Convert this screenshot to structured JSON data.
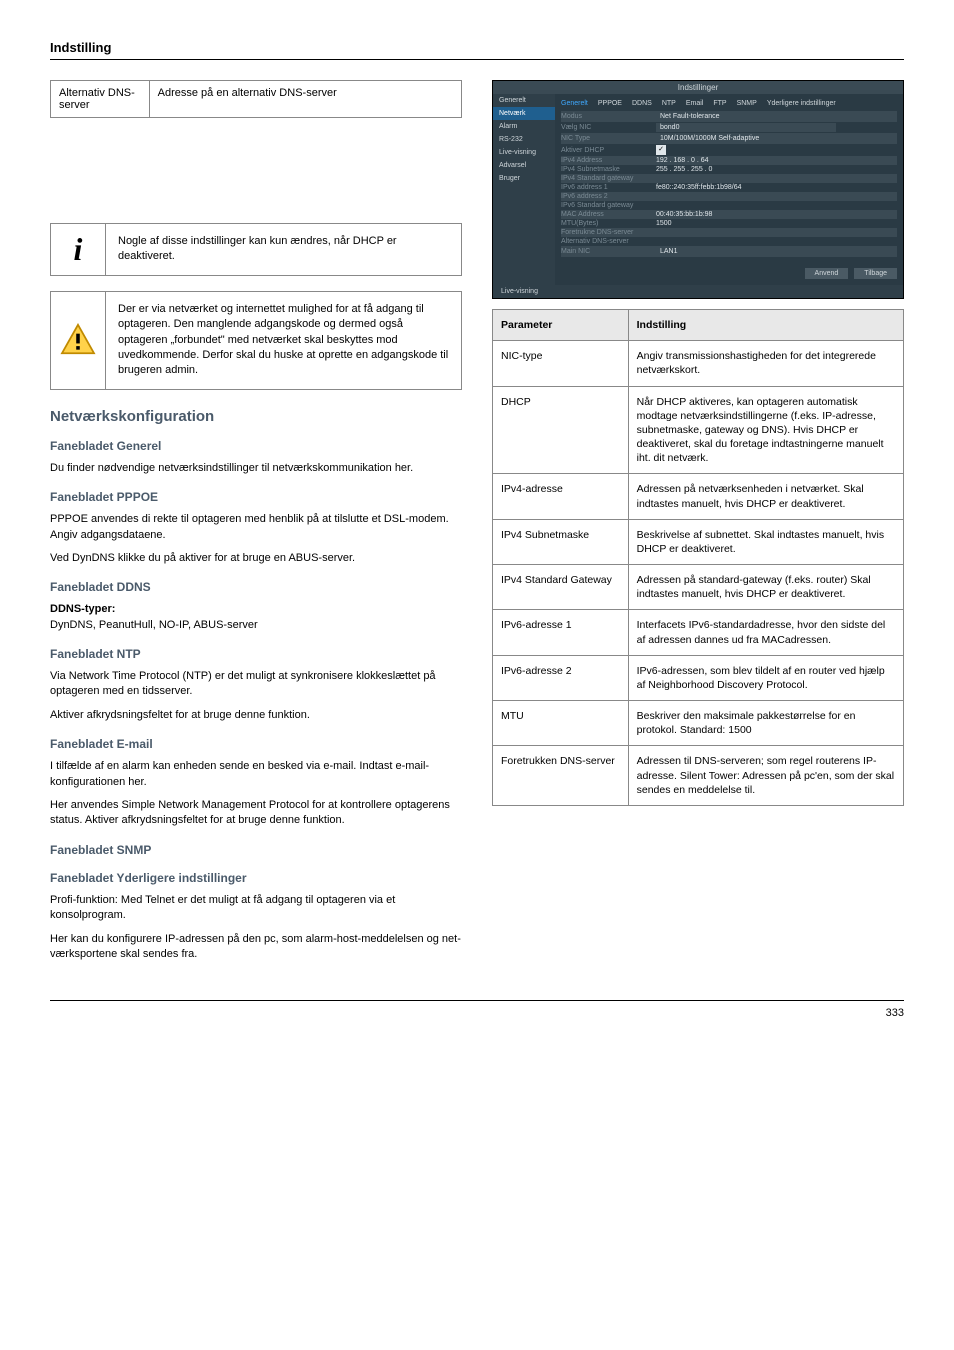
{
  "header": "Indstilling",
  "footer": "333",
  "left": {
    "row1": {
      "label": "Alternativ DNS-server",
      "value": "Adresse på en alternativ DNS-server"
    },
    "info_box": "Nogle af disse indstillinger kan kun ændres, når DHCP er deaktiveret.",
    "warn_box": "Der er via netværket og internettet mulighed for at få adgang til optageren. Den manglende adgangskode og dermed også optageren „forbundet\" med netværket skal beskyttes mod uvedkommende. Derfor skal du huske at oprette en adgangskode til brugeren admin.",
    "heading": "Netværkskonfiguration",
    "sub_general": "Fanebladet Generel",
    "p_general": "Du finder nødvendige netværksindstillinger til netværkskommunikation her.",
    "sub_pppoe": "Fanebladet PPPOE",
    "p_pppoe_1": "PPPOE anvendes di rekte til optageren med henblik på at tilslutte et DSL-modem. Angiv adgangsdataene.",
    "p_pppoe_2": "Ved DynDNS klikke du på aktiver for at bruge en ABUS-server.",
    "sub_ddns": "Fanebladet DDNS",
    "p_ddns_header": "DDNS-typer:",
    "p_ddns_body": "DynDNS, PeanutHull, NO-IP, ABUS-server",
    "sub_ntp": "Fanebladet NTP",
    "p_ntp_1": "Via Network Time Protocol (NTP) er det muligt at synkronisere klokkeslættet på optageren med en tidsserver.",
    "p_ntp_2": "Aktiver afkrydsningsfeltet for at bruge denne funktion.",
    "sub_email": "Fanebladet E-mail",
    "p_email_1": "I tilfælde af en alarm kan enheden sende en besked via e-mail. Indtast e-mail-konfigurationen her.",
    "p_email_2": "Her anvendes Simple Network Management Protocol for at kontrollere optagerens status. Aktiver afkrydsningsfeltet for at bruge denne funktion.",
    "sub_snmp": "Fanebladet SNMP",
    "sub_more": "Fanebladet Yderligere indstillinger",
    "p_more_profi": "Profi-funktion: Med Telnet er det muligt at få adgang til optageren via et konsolprogram.",
    "p_more": "Her kan du konfigurere IP-adressen på den pc, som alarm-host-meddelelsen og net-værksportene skal sendes fra."
  },
  "screenshot": {
    "window_title": "Indstillinger",
    "sidebar": [
      "Generelt",
      "Netværk",
      "Alarm",
      "RS-232",
      "Live-visning",
      "Advarsel",
      "Bruger"
    ],
    "tabs": [
      "Generelt",
      "PPPOE",
      "DDNS",
      "NTP",
      "Email",
      "FTP",
      "SNMP",
      "Yderligere indstillinger"
    ],
    "rows": [
      {
        "lab": "Modus",
        "val": "Net Fault-tolerance",
        "dd": true
      },
      {
        "lab": "Vælg NIC",
        "val": "bond0",
        "dd": true
      },
      {
        "lab": "NIC Type",
        "val": "10M/100M/1000M Self-adaptive",
        "dd": true
      },
      {
        "lab": "Aktiver DHCP",
        "chk": true
      },
      {
        "lab": "IPv4 Address",
        "val": "192 . 168 . 0   . 64"
      },
      {
        "lab": "IPv4 Subnetmaske",
        "val": "255 . 255 . 255 . 0"
      },
      {
        "lab": "IPv4 Standard gateway",
        "val": ""
      },
      {
        "lab": "IPv6 address 1",
        "val": "fe80::240:35ff:febb:1b98/64"
      },
      {
        "lab": "IPv6 address 2",
        "val": ""
      },
      {
        "lab": "IPv6 Standard gateway",
        "val": ""
      },
      {
        "lab": "MAC Address",
        "val": "00:40:35:bb:1b:98"
      },
      {
        "lab": "MTU(Bytes)",
        "val": "1500"
      },
      {
        "lab": "Foretrukne DNS-server",
        "val": ""
      },
      {
        "lab": "Alternativ DNS-server",
        "val": ""
      },
      {
        "lab": "Main NIC",
        "val": "LAN1",
        "dd": true
      }
    ],
    "bottom_left": "Live-visning",
    "btn_apply": "Anvend",
    "btn_back": "Tilbage"
  },
  "right_table": {
    "head": {
      "c1": "Parameter",
      "c2": "Indstilling"
    },
    "rows": [
      {
        "c1": "NIC-type",
        "c2": "Angiv transmissionshastigheden for det integrerede netværkskort."
      },
      {
        "c1": "DHCP",
        "c2": "Når DHCP aktiveres, kan optageren automatisk modtage netværksindstillingerne (f.eks. IP-adresse, subnetmaske, gateway og DNS). Hvis DHCP er deaktiveret, skal du foretage indtastningerne manuelt iht. dit netværk."
      },
      {
        "c1": "IPv4-adresse",
        "c2": "Adressen på netværksenheden i netværket. Skal indtastes manuelt, hvis DHCP er deaktiveret."
      },
      {
        "c1": "IPv4 Subnetmaske",
        "c2": "Beskrivelse af subnettet. Skal indtastes manuelt, hvis DHCP er deaktiveret."
      },
      {
        "c1": "IPv4 Standard Gateway",
        "c2": "Adressen på standard-gateway (f.eks. router) Skal indtastes manuelt, hvis DHCP er deaktiveret."
      },
      {
        "c1": "IPv6-adresse 1",
        "c2": "Interfacets IPv6-standardadresse, hvor den sidste del af adressen dannes ud fra MACadressen."
      },
      {
        "c1": "IPv6-adresse 2",
        "c2": "IPv6-adressen, som blev tildelt af en router ved hjælp af Neighborhood Discovery Protocol."
      },
      {
        "c1": "MTU",
        "c2": "Beskriver den maksimale pakkestørrelse for en protokol. Standard: 1500"
      },
      {
        "c1": "Foretrukken DNS-server",
        "c2": "Adressen til DNS-serveren; som regel routerens IP-adresse. Silent Tower: Adressen på pc'en, som der skal sendes en meddelelse til."
      }
    ]
  }
}
